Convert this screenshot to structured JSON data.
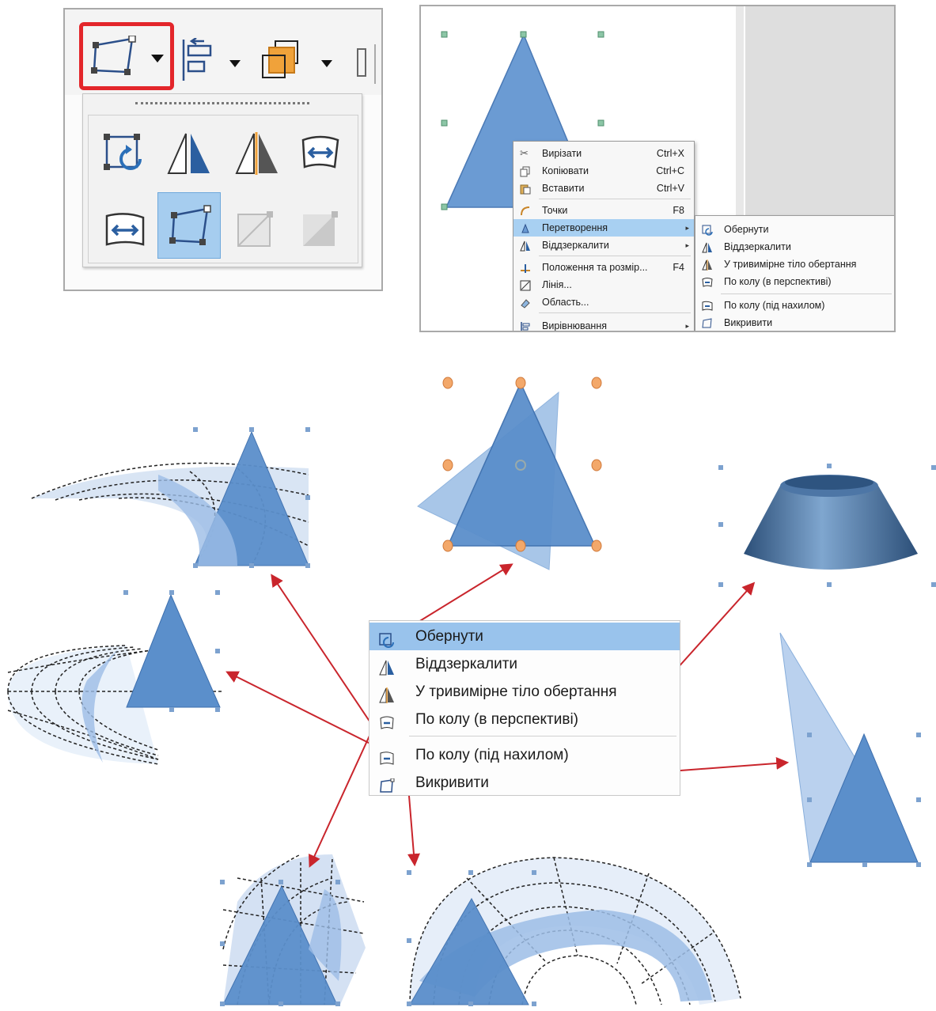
{
  "context_menu": {
    "items": [
      {
        "label": "Вирізати",
        "shortcut": "Ctrl+X",
        "icon": "scissors-icon"
      },
      {
        "label": "Копіювати",
        "shortcut": "Ctrl+C",
        "icon": "copy-icon"
      },
      {
        "label": "Вставити",
        "shortcut": "Ctrl+V",
        "icon": "paste-icon"
      },
      {
        "label": "Точки",
        "shortcut": "F8",
        "icon": "points-icon"
      },
      {
        "label": "Перетворення",
        "shortcut": "",
        "icon": "transform-icon"
      },
      {
        "label": "Віддзеркалити",
        "shortcut": "",
        "icon": "flip-icon"
      },
      {
        "label": "Положення та розмір...",
        "shortcut": "F4",
        "icon": "position-size-icon"
      },
      {
        "label": "Лінія...",
        "shortcut": "",
        "icon": "line-icon"
      },
      {
        "label": "Область...",
        "shortcut": "",
        "icon": "area-icon"
      },
      {
        "label": "Вирівнювання",
        "shortcut": "",
        "icon": "align-icon"
      }
    ]
  },
  "transform_submenu": {
    "items": [
      {
        "label": "Обернути",
        "icon": "rotate-icon"
      },
      {
        "label": "Віддзеркалити",
        "icon": "flip-icon"
      },
      {
        "label": "У тривимірне тіло обертання",
        "icon": "3d-rotation-object-icon"
      },
      {
        "label": "По колу (в перспективі)",
        "icon": "circle-perspective-icon"
      },
      {
        "label": "По колу (під нахилом)",
        "icon": "circle-slant-icon"
      },
      {
        "label": "Викривити",
        "icon": "distort-icon"
      }
    ]
  },
  "colors": {
    "shape_fill": "#5b8fcb",
    "shape_stroke": "#3d6fae",
    "highlight": "#99c3ec",
    "callout_arrow": "#c9252c",
    "selection_box": "#e3262b"
  }
}
